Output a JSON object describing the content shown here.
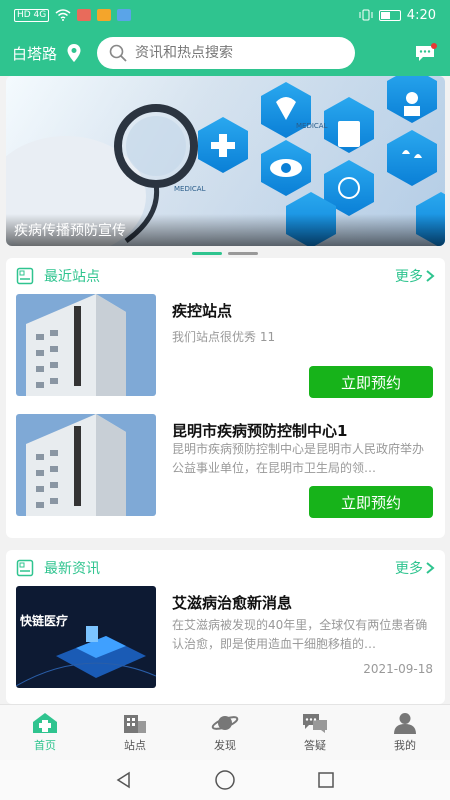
{
  "status_bar": {
    "network": "HD 4G",
    "time": "4:20"
  },
  "header": {
    "city": "白塔路",
    "search_placeholder": "资讯和热点搜索"
  },
  "banner": {
    "caption": "疾病传播预防宣传",
    "slide_count": 2,
    "active_slide": 1
  },
  "stations": {
    "title": "最近站点",
    "more_label": "更多",
    "items": [
      {
        "title": "疾控站点",
        "description": "我们站点很优秀 11",
        "button": "立即预约"
      },
      {
        "title": "昆明市疾病预防控制中心1",
        "description": "昆明市疾病预防控制中心是昆明市人民政府举办公益事业单位，在昆明市卫生局的领…",
        "button": "立即预约"
      }
    ]
  },
  "news": {
    "title": "最新资讯",
    "more_label": "更多",
    "items": [
      {
        "title": "艾滋病治愈新消息",
        "summary": "在艾滋病被发现的40年里，全球仅有两位患者确认治愈，即是使用造血干细胞移植的…",
        "date": "2021-09-18",
        "thumb_text": "快链医疗"
      }
    ]
  },
  "tabbar": {
    "items": [
      {
        "label": "首页",
        "icon": "home-icon",
        "active": true
      },
      {
        "label": "站点",
        "icon": "building-icon",
        "active": false
      },
      {
        "label": "发现",
        "icon": "planet-icon",
        "active": false
      },
      {
        "label": "答疑",
        "icon": "chat-icon",
        "active": false
      },
      {
        "label": "我的",
        "icon": "user-icon",
        "active": false
      }
    ]
  },
  "colors": {
    "primary": "#2fc48f",
    "button_green": "#17b31a",
    "muted_text": "#999999"
  }
}
